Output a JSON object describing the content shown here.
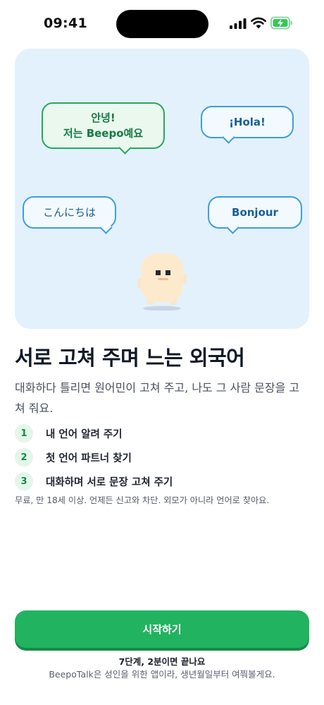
{
  "status_bar": {
    "time": "09:41"
  },
  "hero": {
    "bubbles": {
      "korean_line1": "안녕!",
      "korean_line2": "저는 Beepo예요",
      "spanish": "¡Hola!",
      "japanese": "こんにちは",
      "french": "Bonjour"
    }
  },
  "headline": "서로 고쳐 주며 느는 외국어",
  "description": "대화하다 틀리면 원어민이 고쳐 주고, 나도 그 사람 문장을 고쳐 줘요.",
  "steps": [
    {
      "number": "1",
      "label": "내 언어 알려 주기"
    },
    {
      "number": "2",
      "label": "첫 언어 파트너 찾기"
    },
    {
      "number": "3",
      "label": "대화하며 서로 문장 고쳐 주기"
    }
  ],
  "fine_print": "무료, 만 18세 이상. 언제든 신고와 차단. 외모가 아니라 언어로 찾아요.",
  "cta": {
    "label": "시작하기",
    "subtitle": "7단계, 2분이면 끝나요",
    "note": "BeepoTalk은 성인을 위한 앱이라, 생년월일부터 여쭤볼게요."
  },
  "colors": {
    "accent_green": "#21b35f",
    "hero_background": "#e3f1fc",
    "bubble_blue": "#3aa0dd",
    "bubble_green": "#24aa5c"
  }
}
